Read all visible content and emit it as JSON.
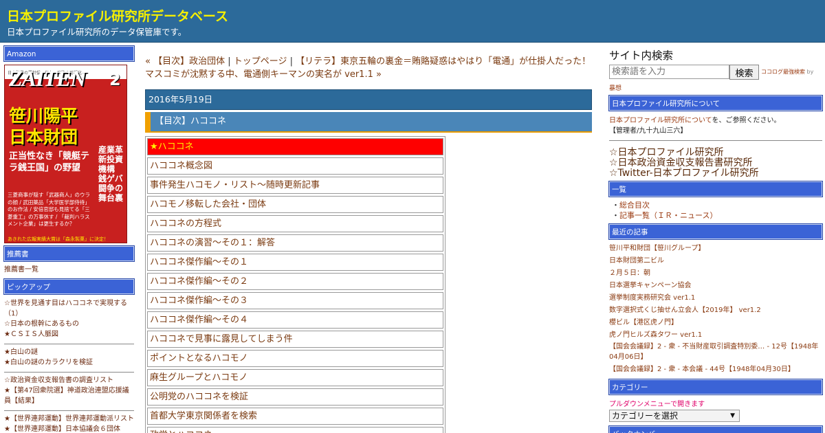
{
  "header": {
    "title": "日本プロファイル研究所データベース",
    "description": "日本プロファイル研究所のデータ保管庫です。"
  },
  "left": {
    "amazon_head": "Amazon",
    "ad": {
      "top_line": "日本財界の羅針盤・権力・腐敗の可視化",
      "brand": "ZAITEN",
      "issue": "2",
      "headline_1": "笹川陽平",
      "headline_2": "日本財団",
      "sub": "正当性なき「競艇テラ銭王国」の野望",
      "side": "産業革新投資機構 銭ゲバ闘争の舞台裏",
      "lines": "三菱商事が隠す「武器商人」のウラの顔 / 武田薬品「大学医学部侍待」のお作法 / 安倍官邸も見捨てる「三菱重工」の万事休す / 「裁判ハラスメント企業」は更生するか？",
      "foot": "あきれた広報実績大賞は「森永製菓」に決定！"
    },
    "recommend_head": "推薦書",
    "recommend_link": "推薦書一覧",
    "pickup_head": "ピックアップ",
    "pickup_groups": [
      [
        "☆世界を見通す目はハココネで実現する（1）",
        "☆日本の根幹にあるもの",
        "★ＣＳＩＳ人脈図"
      ],
      [
        "★白山の謎",
        "★白山の謎のカラクリを検証"
      ],
      [
        "☆政治資金収支報告書の調査リスト",
        "★【第47回衆院選】神道政治連盟応援議員【結果】"
      ],
      [
        "★【世界連邦運動】世界連邦運動派リスト",
        "★【世界連邦運動】日本協議会６団体"
      ]
    ]
  },
  "main": {
    "nav_prev": "« 【目次】政治団体",
    "nav_sep1": " | ",
    "nav_top": "トップページ",
    "nav_sep2": " | ",
    "nav_next": "【リテラ】東京五輪の裏金＝賄賂疑惑はやはり「電通」が仕掛人だった！マスコミが沈黙する中、電通側キーマンの実名が ver1.1 »",
    "date": "2016年5月19日",
    "post_title": "【目次】ハココネ",
    "toc_head": "★ハココネ",
    "toc": [
      "ハココネ概念図",
      "事件発生ハコモノ・リスト〜随時更新記事",
      "ハコモノ移転した会社・団体",
      "ハココネの方程式",
      "ハココネの演習〜その１：解答",
      "ハココネ傑作編〜その１",
      "ハココネ傑作編〜その２",
      "ハココネ傑作編〜その３",
      "ハココネ傑作編〜その４",
      "ハココネで見事に露見してしまう件",
      "ポイントとなるハコモノ",
      "麻生グループとハコモノ",
      "公明党のハココネを検証",
      "首都大学東京関係者を検索",
      "政党とハココネ"
    ]
  },
  "right": {
    "search_title": "サイト内検索",
    "search_placeholder": "検索語を入力",
    "search_button": "検索",
    "search_credit_link": "ココログ最強検索",
    "search_credit_by": " by",
    "search_credit_author": "暴想",
    "about_head": "日本プロファイル研究所について",
    "about_link": "日本プロファイル研究所について",
    "about_text": "を、ご参照ください。",
    "about_admin": "【管理者/九十九山三六】",
    "big_links": [
      "☆日本プロファイル研究所",
      "☆日本政治資金収支報告書研究所",
      "☆Twitter-日本プロファイル研究所"
    ],
    "list_head": "一覧",
    "list_links": [
      "総合目次",
      "記事一覧（ＩＲ・ニュース）"
    ],
    "recent_head": "最近の記事",
    "recent": [
      "笹川平和財団【笹川グループ】",
      "日本財団第二ビル",
      "２月５日：朝",
      "日本選挙キャンペーン協会",
      "選挙制度実務研究会 ver1.1",
      "数字選択式くじ抽せん立会人【2019年】 ver1.2",
      "櫻ビル【港区虎ノ門】",
      "虎ノ門ヒルズ森タワー ver1.1"
    ],
    "recent_multi": [
      "【国会会議録】2 - 衆 - 不当財産取引調査特別委… - 12号【1948年04月06日】",
      "【国会会議録】2 - 衆 - 本会議 - 44号【1948年04月30日】"
    ],
    "category_head": "カテゴリー",
    "category_note": "プルダウンメニューで開きます",
    "category_select": "カテゴリーを選択",
    "backnumber_head": "バックナンバー"
  },
  "colors": {
    "header_bg": "#2c6a9a",
    "title_yellow": "#f6f000",
    "sidebar_head_blue": "#3b63d6",
    "toc_head_red": "#fe0000",
    "accent_orange": "#f0a000"
  }
}
